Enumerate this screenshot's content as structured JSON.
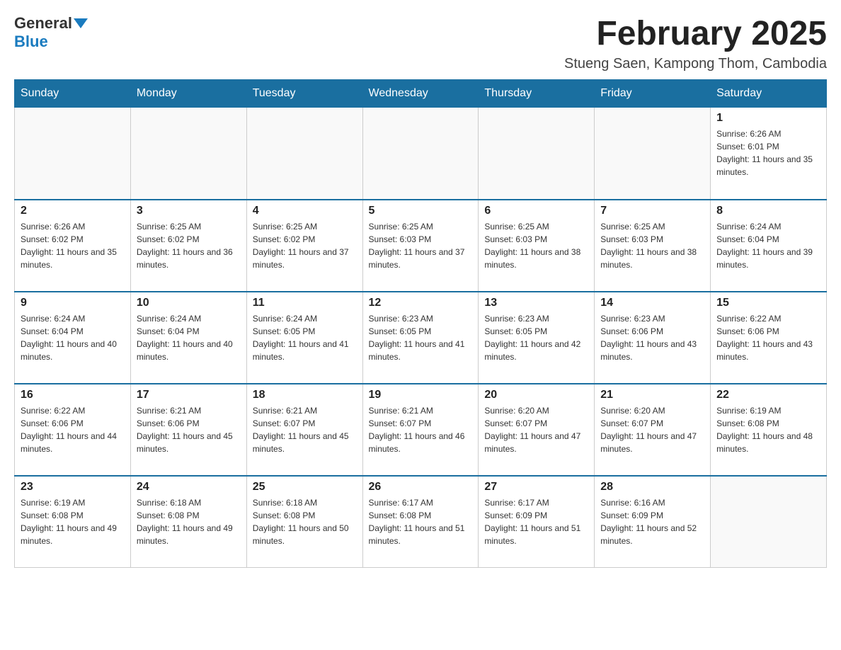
{
  "header": {
    "logo": {
      "general": "General",
      "blue": "Blue"
    },
    "title": "February 2025",
    "location": "Stueng Saen, Kampong Thom, Cambodia"
  },
  "weekdays": [
    "Sunday",
    "Monday",
    "Tuesday",
    "Wednesday",
    "Thursday",
    "Friday",
    "Saturday"
  ],
  "weeks": [
    [
      {
        "day": "",
        "sunrise": "",
        "sunset": "",
        "daylight": "",
        "empty": true
      },
      {
        "day": "",
        "sunrise": "",
        "sunset": "",
        "daylight": "",
        "empty": true
      },
      {
        "day": "",
        "sunrise": "",
        "sunset": "",
        "daylight": "",
        "empty": true
      },
      {
        "day": "",
        "sunrise": "",
        "sunset": "",
        "daylight": "",
        "empty": true
      },
      {
        "day": "",
        "sunrise": "",
        "sunset": "",
        "daylight": "",
        "empty": true
      },
      {
        "day": "",
        "sunrise": "",
        "sunset": "",
        "daylight": "",
        "empty": true
      },
      {
        "day": "1",
        "sunrise": "Sunrise: 6:26 AM",
        "sunset": "Sunset: 6:01 PM",
        "daylight": "Daylight: 11 hours and 35 minutes.",
        "empty": false
      }
    ],
    [
      {
        "day": "2",
        "sunrise": "Sunrise: 6:26 AM",
        "sunset": "Sunset: 6:02 PM",
        "daylight": "Daylight: 11 hours and 35 minutes.",
        "empty": false
      },
      {
        "day": "3",
        "sunrise": "Sunrise: 6:25 AM",
        "sunset": "Sunset: 6:02 PM",
        "daylight": "Daylight: 11 hours and 36 minutes.",
        "empty": false
      },
      {
        "day": "4",
        "sunrise": "Sunrise: 6:25 AM",
        "sunset": "Sunset: 6:02 PM",
        "daylight": "Daylight: 11 hours and 37 minutes.",
        "empty": false
      },
      {
        "day": "5",
        "sunrise": "Sunrise: 6:25 AM",
        "sunset": "Sunset: 6:03 PM",
        "daylight": "Daylight: 11 hours and 37 minutes.",
        "empty": false
      },
      {
        "day": "6",
        "sunrise": "Sunrise: 6:25 AM",
        "sunset": "Sunset: 6:03 PM",
        "daylight": "Daylight: 11 hours and 38 minutes.",
        "empty": false
      },
      {
        "day": "7",
        "sunrise": "Sunrise: 6:25 AM",
        "sunset": "Sunset: 6:03 PM",
        "daylight": "Daylight: 11 hours and 38 minutes.",
        "empty": false
      },
      {
        "day": "8",
        "sunrise": "Sunrise: 6:24 AM",
        "sunset": "Sunset: 6:04 PM",
        "daylight": "Daylight: 11 hours and 39 minutes.",
        "empty": false
      }
    ],
    [
      {
        "day": "9",
        "sunrise": "Sunrise: 6:24 AM",
        "sunset": "Sunset: 6:04 PM",
        "daylight": "Daylight: 11 hours and 40 minutes.",
        "empty": false
      },
      {
        "day": "10",
        "sunrise": "Sunrise: 6:24 AM",
        "sunset": "Sunset: 6:04 PM",
        "daylight": "Daylight: 11 hours and 40 minutes.",
        "empty": false
      },
      {
        "day": "11",
        "sunrise": "Sunrise: 6:24 AM",
        "sunset": "Sunset: 6:05 PM",
        "daylight": "Daylight: 11 hours and 41 minutes.",
        "empty": false
      },
      {
        "day": "12",
        "sunrise": "Sunrise: 6:23 AM",
        "sunset": "Sunset: 6:05 PM",
        "daylight": "Daylight: 11 hours and 41 minutes.",
        "empty": false
      },
      {
        "day": "13",
        "sunrise": "Sunrise: 6:23 AM",
        "sunset": "Sunset: 6:05 PM",
        "daylight": "Daylight: 11 hours and 42 minutes.",
        "empty": false
      },
      {
        "day": "14",
        "sunrise": "Sunrise: 6:23 AM",
        "sunset": "Sunset: 6:06 PM",
        "daylight": "Daylight: 11 hours and 43 minutes.",
        "empty": false
      },
      {
        "day": "15",
        "sunrise": "Sunrise: 6:22 AM",
        "sunset": "Sunset: 6:06 PM",
        "daylight": "Daylight: 11 hours and 43 minutes.",
        "empty": false
      }
    ],
    [
      {
        "day": "16",
        "sunrise": "Sunrise: 6:22 AM",
        "sunset": "Sunset: 6:06 PM",
        "daylight": "Daylight: 11 hours and 44 minutes.",
        "empty": false
      },
      {
        "day": "17",
        "sunrise": "Sunrise: 6:21 AM",
        "sunset": "Sunset: 6:06 PM",
        "daylight": "Daylight: 11 hours and 45 minutes.",
        "empty": false
      },
      {
        "day": "18",
        "sunrise": "Sunrise: 6:21 AM",
        "sunset": "Sunset: 6:07 PM",
        "daylight": "Daylight: 11 hours and 45 minutes.",
        "empty": false
      },
      {
        "day": "19",
        "sunrise": "Sunrise: 6:21 AM",
        "sunset": "Sunset: 6:07 PM",
        "daylight": "Daylight: 11 hours and 46 minutes.",
        "empty": false
      },
      {
        "day": "20",
        "sunrise": "Sunrise: 6:20 AM",
        "sunset": "Sunset: 6:07 PM",
        "daylight": "Daylight: 11 hours and 47 minutes.",
        "empty": false
      },
      {
        "day": "21",
        "sunrise": "Sunrise: 6:20 AM",
        "sunset": "Sunset: 6:07 PM",
        "daylight": "Daylight: 11 hours and 47 minutes.",
        "empty": false
      },
      {
        "day": "22",
        "sunrise": "Sunrise: 6:19 AM",
        "sunset": "Sunset: 6:08 PM",
        "daylight": "Daylight: 11 hours and 48 minutes.",
        "empty": false
      }
    ],
    [
      {
        "day": "23",
        "sunrise": "Sunrise: 6:19 AM",
        "sunset": "Sunset: 6:08 PM",
        "daylight": "Daylight: 11 hours and 49 minutes.",
        "empty": false
      },
      {
        "day": "24",
        "sunrise": "Sunrise: 6:18 AM",
        "sunset": "Sunset: 6:08 PM",
        "daylight": "Daylight: 11 hours and 49 minutes.",
        "empty": false
      },
      {
        "day": "25",
        "sunrise": "Sunrise: 6:18 AM",
        "sunset": "Sunset: 6:08 PM",
        "daylight": "Daylight: 11 hours and 50 minutes.",
        "empty": false
      },
      {
        "day": "26",
        "sunrise": "Sunrise: 6:17 AM",
        "sunset": "Sunset: 6:08 PM",
        "daylight": "Daylight: 11 hours and 51 minutes.",
        "empty": false
      },
      {
        "day": "27",
        "sunrise": "Sunrise: 6:17 AM",
        "sunset": "Sunset: 6:09 PM",
        "daylight": "Daylight: 11 hours and 51 minutes.",
        "empty": false
      },
      {
        "day": "28",
        "sunrise": "Sunrise: 6:16 AM",
        "sunset": "Sunset: 6:09 PM",
        "daylight": "Daylight: 11 hours and 52 minutes.",
        "empty": false
      },
      {
        "day": "",
        "sunrise": "",
        "sunset": "",
        "daylight": "",
        "empty": true
      }
    ]
  ]
}
